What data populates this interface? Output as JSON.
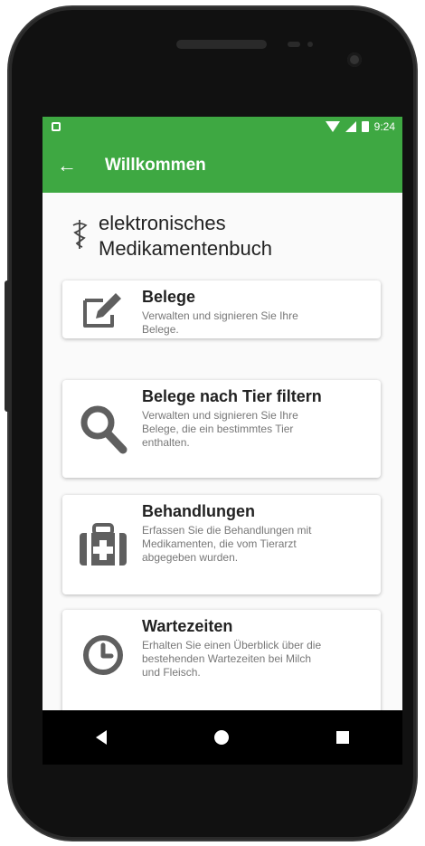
{
  "status_bar": {
    "time": "9:24"
  },
  "app_bar": {
    "title": "Willkommen"
  },
  "header": {
    "line1": "elektronisches",
    "line2": "Medikamentenbuch"
  },
  "cards": [
    {
      "icon": "edit-icon",
      "title": "Belege",
      "desc_lines": [
        "Verwalten und signieren Sie Ihre",
        "Belege."
      ]
    },
    {
      "icon": "search-icon",
      "title": "Belege nach Tier filtern",
      "desc_lines": [
        "Verwalten und signieren Sie Ihre",
        "Belege, die ein bestimmtes Tier",
        "enthalten."
      ]
    },
    {
      "icon": "medical-kit-icon",
      "title": "Behandlungen",
      "desc_lines": [
        "Erfassen Sie die Behandlungen mit",
        "Medikamenten, die vom Tierarzt",
        "abgegeben wurden."
      ]
    },
    {
      "icon": "clock-icon",
      "title": "Wartezeiten",
      "desc_lines": [
        "Erhalten Sie einen Überblick über die",
        "bestehenden Wartezeiten bei Milch",
        "und Fleisch."
      ]
    }
  ],
  "colors": {
    "primary": "#3ea842",
    "icon_gray": "#5f5f5f"
  }
}
